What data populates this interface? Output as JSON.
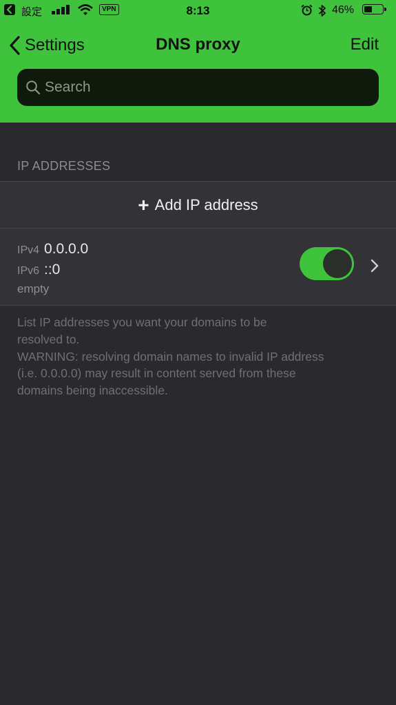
{
  "status_bar": {
    "carrier": "設定",
    "vpn": "VPN",
    "time": "8:13",
    "battery_percent": "46%",
    "battery_level": 0.46,
    "icons": [
      "back-app-icon",
      "signal-icon",
      "wifi-icon",
      "alarm-icon",
      "bluetooth-icon",
      "battery-icon"
    ]
  },
  "nav": {
    "back_label": "Settings",
    "title": "DNS proxy",
    "edit_label": "Edit"
  },
  "search": {
    "placeholder": "Search",
    "value": ""
  },
  "section": {
    "header": "IP ADDRESSES"
  },
  "add_button": {
    "icon": "plus-icon",
    "label": "Add IP address"
  },
  "entries": [
    {
      "ipv4_key": "IPv4",
      "ipv4_value": "0.0.0.0",
      "ipv6_key": "IPv6",
      "ipv6_value": "::0",
      "note": "empty",
      "enabled": true
    }
  ],
  "footer": {
    "lines": [
      "List IP addresses you want your domains to be",
      "resolved to.",
      "WARNING: resolving domain names to invalid IP address",
      "(i.e. 0.0.0.0) may result in content served from these",
      "domains being inaccessible."
    ]
  },
  "colors": {
    "accent_green": "#3fc33d",
    "background": "#29292e",
    "cell_background": "#323237",
    "search_background": "#0f1a0d"
  }
}
